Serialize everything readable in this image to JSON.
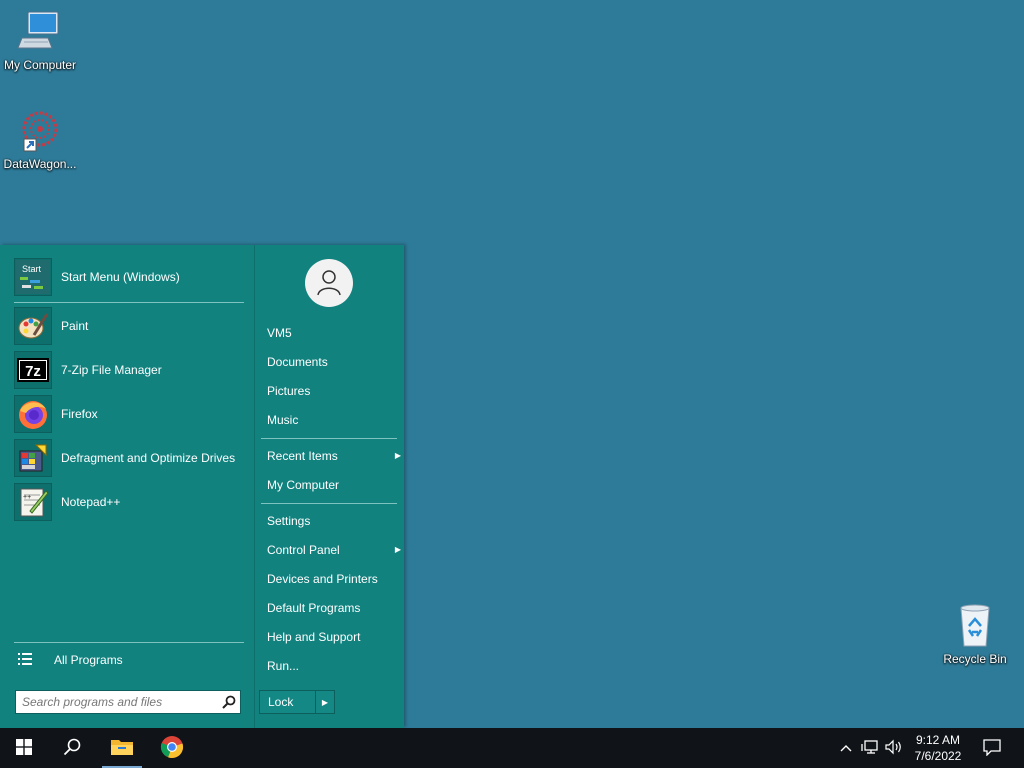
{
  "desktop": {
    "icons": [
      {
        "label": "My Computer"
      },
      {
        "label": "DataWagon..."
      },
      {
        "label": "Recycle Bin"
      }
    ]
  },
  "start_menu": {
    "pinned": [
      {
        "label": "Start Menu (Windows)",
        "icon": "start-menu-icon"
      },
      {
        "label": "Paint",
        "icon": "paint-icon"
      },
      {
        "label": "7-Zip File Manager",
        "icon": "7zip-icon",
        "icon_text": "7z"
      },
      {
        "label": "Firefox",
        "icon": "firefox-icon"
      },
      {
        "label": "Defragment and Optimize Drives",
        "icon": "defrag-icon"
      },
      {
        "label": "Notepad++",
        "icon": "notepadpp-icon"
      }
    ],
    "start_icon_text": "Start",
    "all_programs": "All Programs",
    "search": {
      "placeholder": "Search programs and files"
    },
    "right": {
      "items": [
        {
          "label": "VM5"
        },
        {
          "label": "Documents"
        },
        {
          "label": "Pictures"
        },
        {
          "label": "Music"
        },
        {
          "label": "Recent Items",
          "submenu": true
        },
        {
          "label": "My Computer"
        },
        {
          "label": "Settings"
        },
        {
          "label": "Control Panel",
          "submenu": true
        },
        {
          "label": "Devices and Printers"
        },
        {
          "label": "Default Programs"
        },
        {
          "label": "Help and Support"
        },
        {
          "label": "Run..."
        }
      ],
      "lock_label": "Lock"
    }
  },
  "taskbar": {
    "clock_time": "9:12 AM",
    "clock_date": "7/6/2022"
  },
  "colors": {
    "desktop_bg": "#2e7b99",
    "start_menu_bg": "#12827f",
    "taskbar_bg": "#101419"
  }
}
